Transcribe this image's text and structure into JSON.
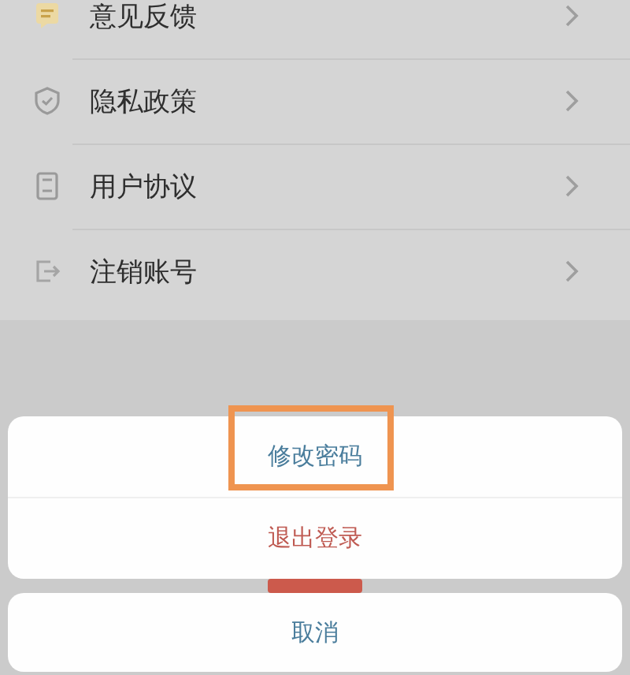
{
  "menu": [
    {
      "label": "意见反馈",
      "kind": "feedback"
    },
    {
      "label": "隐私政策",
      "kind": "privacy"
    },
    {
      "label": "用户协议",
      "kind": "agreement"
    },
    {
      "label": "注销账号",
      "kind": "deregister"
    }
  ],
  "action_sheet": {
    "actions": [
      {
        "label": "修改密码",
        "kind": "normal",
        "highlighted": true
      },
      {
        "label": "退出登录",
        "kind": "danger",
        "highlighted": false
      }
    ],
    "cancel": "取消"
  }
}
